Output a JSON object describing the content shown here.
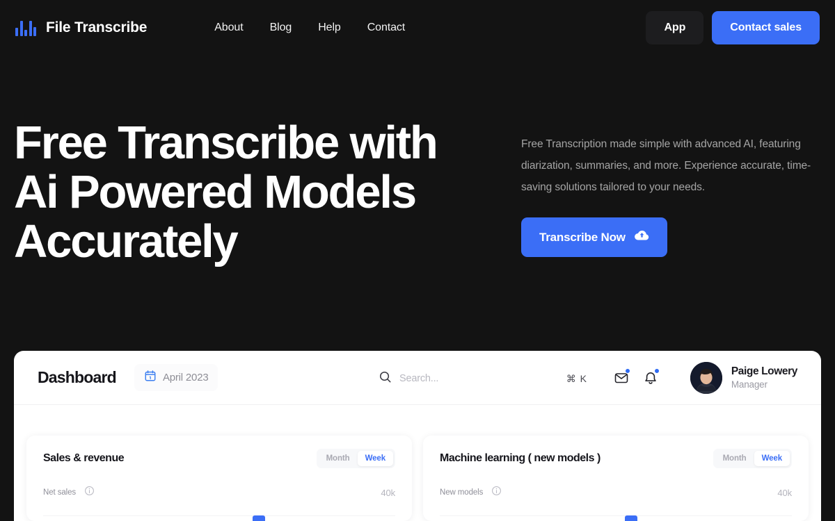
{
  "brand": {
    "name": "File Transcribe",
    "logo_icon": "waveform-icon",
    "accent": "#3b6ef6"
  },
  "nav": {
    "links": [
      {
        "label": "About"
      },
      {
        "label": "Blog"
      },
      {
        "label": "Help"
      },
      {
        "label": "Contact"
      }
    ],
    "app_button": "App",
    "contact_sales_button": "Contact sales"
  },
  "hero": {
    "title": "Free Transcribe with Ai Powered Models Accurately",
    "subtitle": "Free Transcription made simple with advanced AI, featuring diarization, summaries, and more. Experience accurate, time-saving solutions tailored to your needs.",
    "cta_label": "Transcribe Now",
    "cta_icon": "cloud-upload-icon"
  },
  "dashboard": {
    "title": "Dashboard",
    "date_label": "April 2023",
    "calendar_icon": "calendar-icon",
    "search": {
      "placeholder": "Search...",
      "value": "",
      "shortcut": "⌘ K",
      "icon": "search-icon"
    },
    "mail_icon": "mail-icon",
    "bell_icon": "bell-icon",
    "user": {
      "name": "Paige Lowery",
      "role": "Manager",
      "avatar": "user-avatar"
    },
    "cards": [
      {
        "title": "Sales & revenue",
        "segments": [
          {
            "label": "Month",
            "active": false
          },
          {
            "label": "Week",
            "active": true
          }
        ],
        "metric_label": "Net sales",
        "info_icon": "info-icon",
        "axis_value": "40k"
      },
      {
        "title": "Machine learning ( new models )",
        "segments": [
          {
            "label": "Month",
            "active": false
          },
          {
            "label": "Week",
            "active": true
          }
        ],
        "metric_label": "New models",
        "info_icon": "info-icon",
        "axis_value": "40k"
      }
    ]
  }
}
